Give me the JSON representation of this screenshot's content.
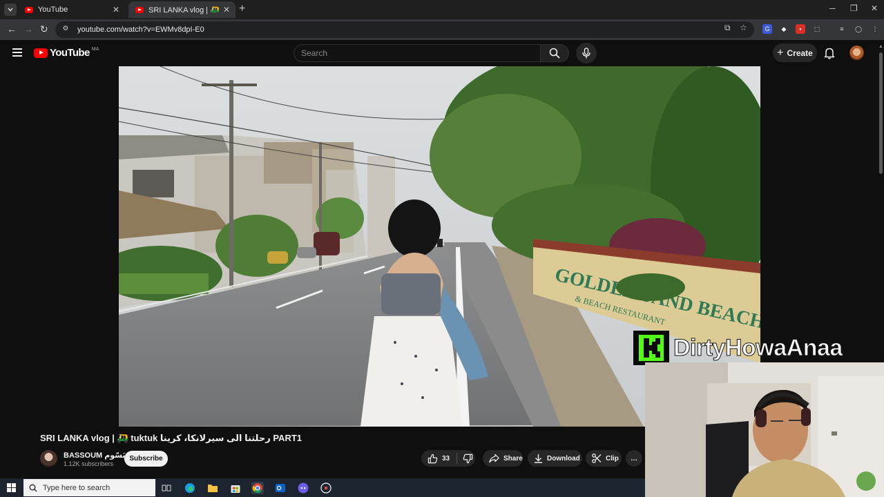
{
  "browser": {
    "tabs": [
      {
        "title": "YouTube",
        "active": false
      },
      {
        "title": "SRI LANKA vlog | 🛺 tuktuk رحلتنا",
        "active": true
      }
    ],
    "new_tab": "+",
    "url": "youtube.com/watch?v=EWMv8dpI-E0"
  },
  "masthead": {
    "logo_text": "YouTube",
    "country_code": "MA",
    "search_placeholder": "Search",
    "create_label": "Create"
  },
  "video": {
    "title": "SRI LANKA vlog | 🛺 tuktuk رحلتنا الى سيرلانكا، كرينا PART1",
    "scene_sign_text": "GOLDEN SAND BEACH HOTEL",
    "scene_sign_sub": "& BEACH RESTAURANT"
  },
  "channel": {
    "name": "BASSOUM بَسّوم",
    "subscribers": "1.12K subscribers",
    "subscribe_label": "Subscribe"
  },
  "actions": {
    "likes": "33",
    "share_label": "Share",
    "download_label": "Download",
    "clip_label": "Clip",
    "more_label": "…"
  },
  "overlay": {
    "streamer_name": "DirtyHowaAnaa",
    "platform_icon": "kick-logo"
  },
  "taskbar": {
    "search_placeholder": "Type here to search"
  },
  "colors": {
    "yt_red": "#ff0000",
    "background": "#0f0f0f",
    "kick_green": "#53fc18"
  }
}
